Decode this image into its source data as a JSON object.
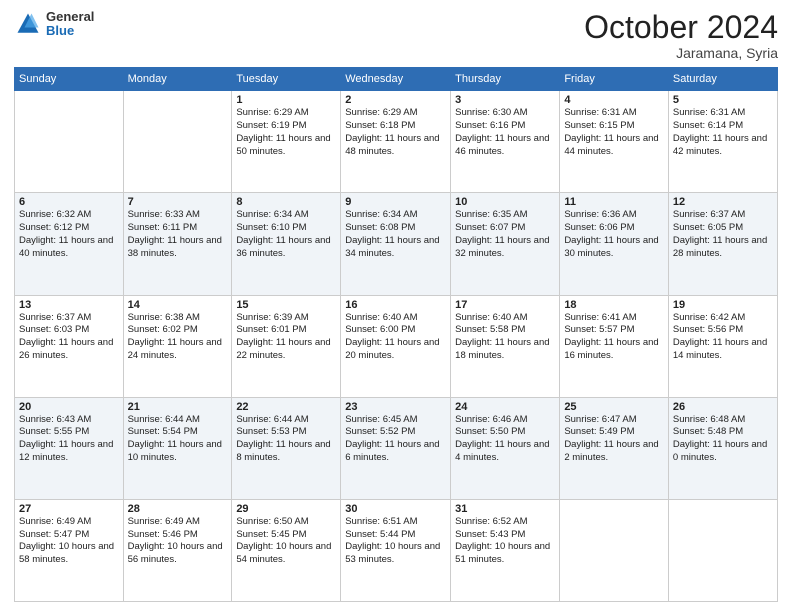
{
  "header": {
    "logo": {
      "general": "General",
      "blue": "Blue"
    },
    "title": "October 2024",
    "subtitle": "Jaramana, Syria"
  },
  "days_of_week": [
    "Sunday",
    "Monday",
    "Tuesday",
    "Wednesday",
    "Thursday",
    "Friday",
    "Saturday"
  ],
  "weeks": [
    [
      {
        "day": "",
        "sunrise": "",
        "sunset": "",
        "daylight": ""
      },
      {
        "day": "",
        "sunrise": "",
        "sunset": "",
        "daylight": ""
      },
      {
        "day": "1",
        "sunrise": "Sunrise: 6:29 AM",
        "sunset": "Sunset: 6:19 PM",
        "daylight": "Daylight: 11 hours and 50 minutes."
      },
      {
        "day": "2",
        "sunrise": "Sunrise: 6:29 AM",
        "sunset": "Sunset: 6:18 PM",
        "daylight": "Daylight: 11 hours and 48 minutes."
      },
      {
        "day": "3",
        "sunrise": "Sunrise: 6:30 AM",
        "sunset": "Sunset: 6:16 PM",
        "daylight": "Daylight: 11 hours and 46 minutes."
      },
      {
        "day": "4",
        "sunrise": "Sunrise: 6:31 AM",
        "sunset": "Sunset: 6:15 PM",
        "daylight": "Daylight: 11 hours and 44 minutes."
      },
      {
        "day": "5",
        "sunrise": "Sunrise: 6:31 AM",
        "sunset": "Sunset: 6:14 PM",
        "daylight": "Daylight: 11 hours and 42 minutes."
      }
    ],
    [
      {
        "day": "6",
        "sunrise": "Sunrise: 6:32 AM",
        "sunset": "Sunset: 6:12 PM",
        "daylight": "Daylight: 11 hours and 40 minutes."
      },
      {
        "day": "7",
        "sunrise": "Sunrise: 6:33 AM",
        "sunset": "Sunset: 6:11 PM",
        "daylight": "Daylight: 11 hours and 38 minutes."
      },
      {
        "day": "8",
        "sunrise": "Sunrise: 6:34 AM",
        "sunset": "Sunset: 6:10 PM",
        "daylight": "Daylight: 11 hours and 36 minutes."
      },
      {
        "day": "9",
        "sunrise": "Sunrise: 6:34 AM",
        "sunset": "Sunset: 6:08 PM",
        "daylight": "Daylight: 11 hours and 34 minutes."
      },
      {
        "day": "10",
        "sunrise": "Sunrise: 6:35 AM",
        "sunset": "Sunset: 6:07 PM",
        "daylight": "Daylight: 11 hours and 32 minutes."
      },
      {
        "day": "11",
        "sunrise": "Sunrise: 6:36 AM",
        "sunset": "Sunset: 6:06 PM",
        "daylight": "Daylight: 11 hours and 30 minutes."
      },
      {
        "day": "12",
        "sunrise": "Sunrise: 6:37 AM",
        "sunset": "Sunset: 6:05 PM",
        "daylight": "Daylight: 11 hours and 28 minutes."
      }
    ],
    [
      {
        "day": "13",
        "sunrise": "Sunrise: 6:37 AM",
        "sunset": "Sunset: 6:03 PM",
        "daylight": "Daylight: 11 hours and 26 minutes."
      },
      {
        "day": "14",
        "sunrise": "Sunrise: 6:38 AM",
        "sunset": "Sunset: 6:02 PM",
        "daylight": "Daylight: 11 hours and 24 minutes."
      },
      {
        "day": "15",
        "sunrise": "Sunrise: 6:39 AM",
        "sunset": "Sunset: 6:01 PM",
        "daylight": "Daylight: 11 hours and 22 minutes."
      },
      {
        "day": "16",
        "sunrise": "Sunrise: 6:40 AM",
        "sunset": "Sunset: 6:00 PM",
        "daylight": "Daylight: 11 hours and 20 minutes."
      },
      {
        "day": "17",
        "sunrise": "Sunrise: 6:40 AM",
        "sunset": "Sunset: 5:58 PM",
        "daylight": "Daylight: 11 hours and 18 minutes."
      },
      {
        "day": "18",
        "sunrise": "Sunrise: 6:41 AM",
        "sunset": "Sunset: 5:57 PM",
        "daylight": "Daylight: 11 hours and 16 minutes."
      },
      {
        "day": "19",
        "sunrise": "Sunrise: 6:42 AM",
        "sunset": "Sunset: 5:56 PM",
        "daylight": "Daylight: 11 hours and 14 minutes."
      }
    ],
    [
      {
        "day": "20",
        "sunrise": "Sunrise: 6:43 AM",
        "sunset": "Sunset: 5:55 PM",
        "daylight": "Daylight: 11 hours and 12 minutes."
      },
      {
        "day": "21",
        "sunrise": "Sunrise: 6:44 AM",
        "sunset": "Sunset: 5:54 PM",
        "daylight": "Daylight: 11 hours and 10 minutes."
      },
      {
        "day": "22",
        "sunrise": "Sunrise: 6:44 AM",
        "sunset": "Sunset: 5:53 PM",
        "daylight": "Daylight: 11 hours and 8 minutes."
      },
      {
        "day": "23",
        "sunrise": "Sunrise: 6:45 AM",
        "sunset": "Sunset: 5:52 PM",
        "daylight": "Daylight: 11 hours and 6 minutes."
      },
      {
        "day": "24",
        "sunrise": "Sunrise: 6:46 AM",
        "sunset": "Sunset: 5:50 PM",
        "daylight": "Daylight: 11 hours and 4 minutes."
      },
      {
        "day": "25",
        "sunrise": "Sunrise: 6:47 AM",
        "sunset": "Sunset: 5:49 PM",
        "daylight": "Daylight: 11 hours and 2 minutes."
      },
      {
        "day": "26",
        "sunrise": "Sunrise: 6:48 AM",
        "sunset": "Sunset: 5:48 PM",
        "daylight": "Daylight: 11 hours and 0 minutes."
      }
    ],
    [
      {
        "day": "27",
        "sunrise": "Sunrise: 6:49 AM",
        "sunset": "Sunset: 5:47 PM",
        "daylight": "Daylight: 10 hours and 58 minutes."
      },
      {
        "day": "28",
        "sunrise": "Sunrise: 6:49 AM",
        "sunset": "Sunset: 5:46 PM",
        "daylight": "Daylight: 10 hours and 56 minutes."
      },
      {
        "day": "29",
        "sunrise": "Sunrise: 6:50 AM",
        "sunset": "Sunset: 5:45 PM",
        "daylight": "Daylight: 10 hours and 54 minutes."
      },
      {
        "day": "30",
        "sunrise": "Sunrise: 6:51 AM",
        "sunset": "Sunset: 5:44 PM",
        "daylight": "Daylight: 10 hours and 53 minutes."
      },
      {
        "day": "31",
        "sunrise": "Sunrise: 6:52 AM",
        "sunset": "Sunset: 5:43 PM",
        "daylight": "Daylight: 10 hours and 51 minutes."
      },
      {
        "day": "",
        "sunrise": "",
        "sunset": "",
        "daylight": ""
      },
      {
        "day": "",
        "sunrise": "",
        "sunset": "",
        "daylight": ""
      }
    ]
  ]
}
